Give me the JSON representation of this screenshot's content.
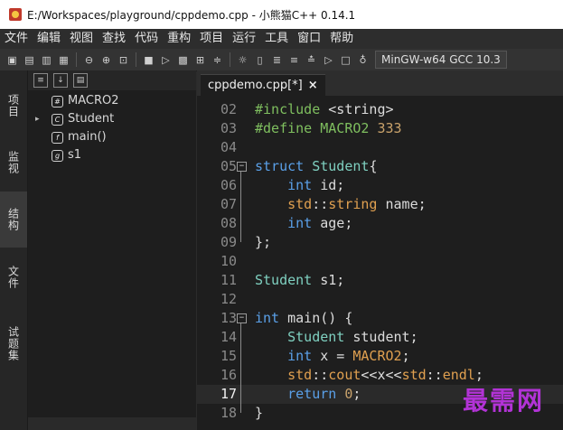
{
  "window": {
    "title": "E:/Workspaces/playground/cppdemo.cpp - 小熊猫C++ 0.14.1"
  },
  "menu": [
    "文件",
    "编辑",
    "视图",
    "查找",
    "代码",
    "重构",
    "项目",
    "运行",
    "工具",
    "窗口",
    "帮助"
  ],
  "toolbar": {
    "compiler": "MinGW-w64 GCC 10.3"
  },
  "rail_tabs": [
    {
      "label": "项目",
      "icon": "project-icon"
    },
    {
      "label": "监视",
      "icon": "watch-icon"
    },
    {
      "label": "结构",
      "icon": "structure-icon"
    },
    {
      "label": "文件",
      "icon": "files-icon"
    },
    {
      "label": "试题集",
      "icon": "problemset-icon"
    }
  ],
  "structure_tree": [
    {
      "badge": "#",
      "label": "MACRO2",
      "expandable": false
    },
    {
      "badge": "C",
      "label": "Student",
      "expandable": true
    },
    {
      "badge": "f",
      "label": "main()",
      "expandable": false
    },
    {
      "badge": "g",
      "label": "s1",
      "expandable": false
    }
  ],
  "editor": {
    "tab_label": "cppdemo.cpp[*]",
    "tab_close": "×",
    "current_line": "17",
    "lines": [
      {
        "n": "02",
        "parts": [
          [
            "pp",
            "#include "
          ],
          [
            "str",
            "<string>"
          ]
        ]
      },
      {
        "n": "03",
        "parts": [
          [
            "pp",
            "#define "
          ],
          [
            "pp",
            "MACRO2 "
          ],
          [
            "num",
            "333"
          ]
        ]
      },
      {
        "n": "04",
        "parts": []
      },
      {
        "n": "05",
        "parts": [
          [
            "kw",
            "struct "
          ],
          [
            "ty",
            "Student"
          ],
          [
            "",
            "{"
          ]
        ]
      },
      {
        "n": "06",
        "parts": [
          [
            "",
            "    "
          ],
          [
            "kw",
            "int "
          ],
          [
            "",
            "id;"
          ]
        ]
      },
      {
        "n": "07",
        "parts": [
          [
            "",
            "    "
          ],
          [
            "ns",
            "std"
          ],
          [
            "",
            "::"
          ],
          [
            "ns",
            "string "
          ],
          [
            "",
            "name;"
          ]
        ]
      },
      {
        "n": "08",
        "parts": [
          [
            "",
            "    "
          ],
          [
            "kw",
            "int "
          ],
          [
            "",
            "age;"
          ]
        ]
      },
      {
        "n": "09",
        "parts": [
          [
            "",
            "};"
          ]
        ]
      },
      {
        "n": "10",
        "parts": []
      },
      {
        "n": "11",
        "parts": [
          [
            "ty",
            "Student "
          ],
          [
            "",
            "s1;"
          ]
        ]
      },
      {
        "n": "12",
        "parts": []
      },
      {
        "n": "13",
        "parts": [
          [
            "kw",
            "int "
          ],
          [
            "",
            "main() {"
          ]
        ]
      },
      {
        "n": "14",
        "parts": [
          [
            "",
            "    "
          ],
          [
            "ty",
            "Student "
          ],
          [
            "",
            "student;"
          ]
        ]
      },
      {
        "n": "15",
        "parts": [
          [
            "",
            "    "
          ],
          [
            "kw",
            "int "
          ],
          [
            "",
            "x = "
          ],
          [
            "ns",
            "MACRO2"
          ],
          [
            "",
            ";"
          ]
        ]
      },
      {
        "n": "16",
        "parts": [
          [
            "",
            "    "
          ],
          [
            "ns",
            "std"
          ],
          [
            "",
            "::"
          ],
          [
            "ns",
            "cout"
          ],
          [
            "",
            "<<x<<"
          ],
          [
            "ns",
            "std"
          ],
          [
            "",
            "::"
          ],
          [
            "ns",
            "endl"
          ],
          [
            "",
            ";"
          ]
        ]
      },
      {
        "n": "17",
        "parts": [
          [
            "",
            "    "
          ],
          [
            "kw",
            "return "
          ],
          [
            "num",
            "0"
          ],
          [
            "",
            ";"
          ]
        ]
      },
      {
        "n": "18",
        "parts": [
          [
            "",
            "}"
          ]
        ]
      }
    ]
  },
  "watermark": "最需网"
}
